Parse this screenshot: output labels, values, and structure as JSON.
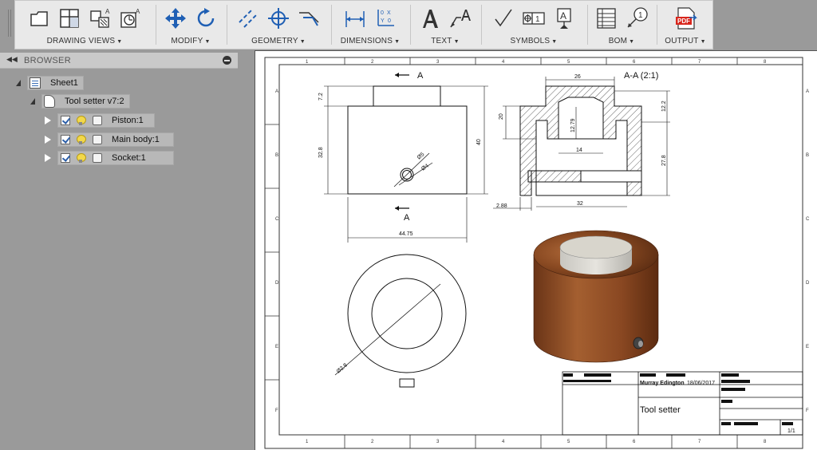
{
  "toolbar": {
    "groups": [
      {
        "label": "DRAWING VIEWS"
      },
      {
        "label": "MODIFY"
      },
      {
        "label": "GEOMETRY"
      },
      {
        "label": "DIMENSIONS"
      },
      {
        "label": "TEXT"
      },
      {
        "label": "SYMBOLS"
      },
      {
        "label": "BOM"
      },
      {
        "label": "OUTPUT"
      }
    ],
    "output_icon_text": "PDF"
  },
  "browser": {
    "title": "BROWSER",
    "sheet": "Sheet1",
    "component": "Tool setter v7:2",
    "items": [
      {
        "label": "Piston:1"
      },
      {
        "label": "Main body:1"
      },
      {
        "label": "Socket:1"
      }
    ]
  },
  "drawing": {
    "border_cols": [
      "1",
      "2",
      "3",
      "4",
      "5",
      "6",
      "7",
      "8"
    ],
    "border_rows": [
      "A",
      "B",
      "C",
      "D",
      "E",
      "F"
    ],
    "front_view": {
      "dims": {
        "d1": "7.2",
        "d2": "32.8",
        "d3": "40",
        "d4": "44.75",
        "d5": "Ø5",
        "d6": "Ø4"
      },
      "section_label_top": "A",
      "section_label_bottom": "A"
    },
    "section_view": {
      "title": "A-A (2:1)",
      "dims": {
        "d1": "26",
        "d2": "20",
        "d3": "12.79",
        "d4": "12.2",
        "d5": "14",
        "d6": "27.8",
        "d7": "2.88",
        "d8": "32"
      }
    },
    "top_view": {
      "dims": {
        "d1": "Ø2.8"
      }
    },
    "title_block": {
      "author": "Murray Edington",
      "date": "18/06/2017",
      "title": "Tool setter",
      "sheet": "1/1"
    }
  }
}
